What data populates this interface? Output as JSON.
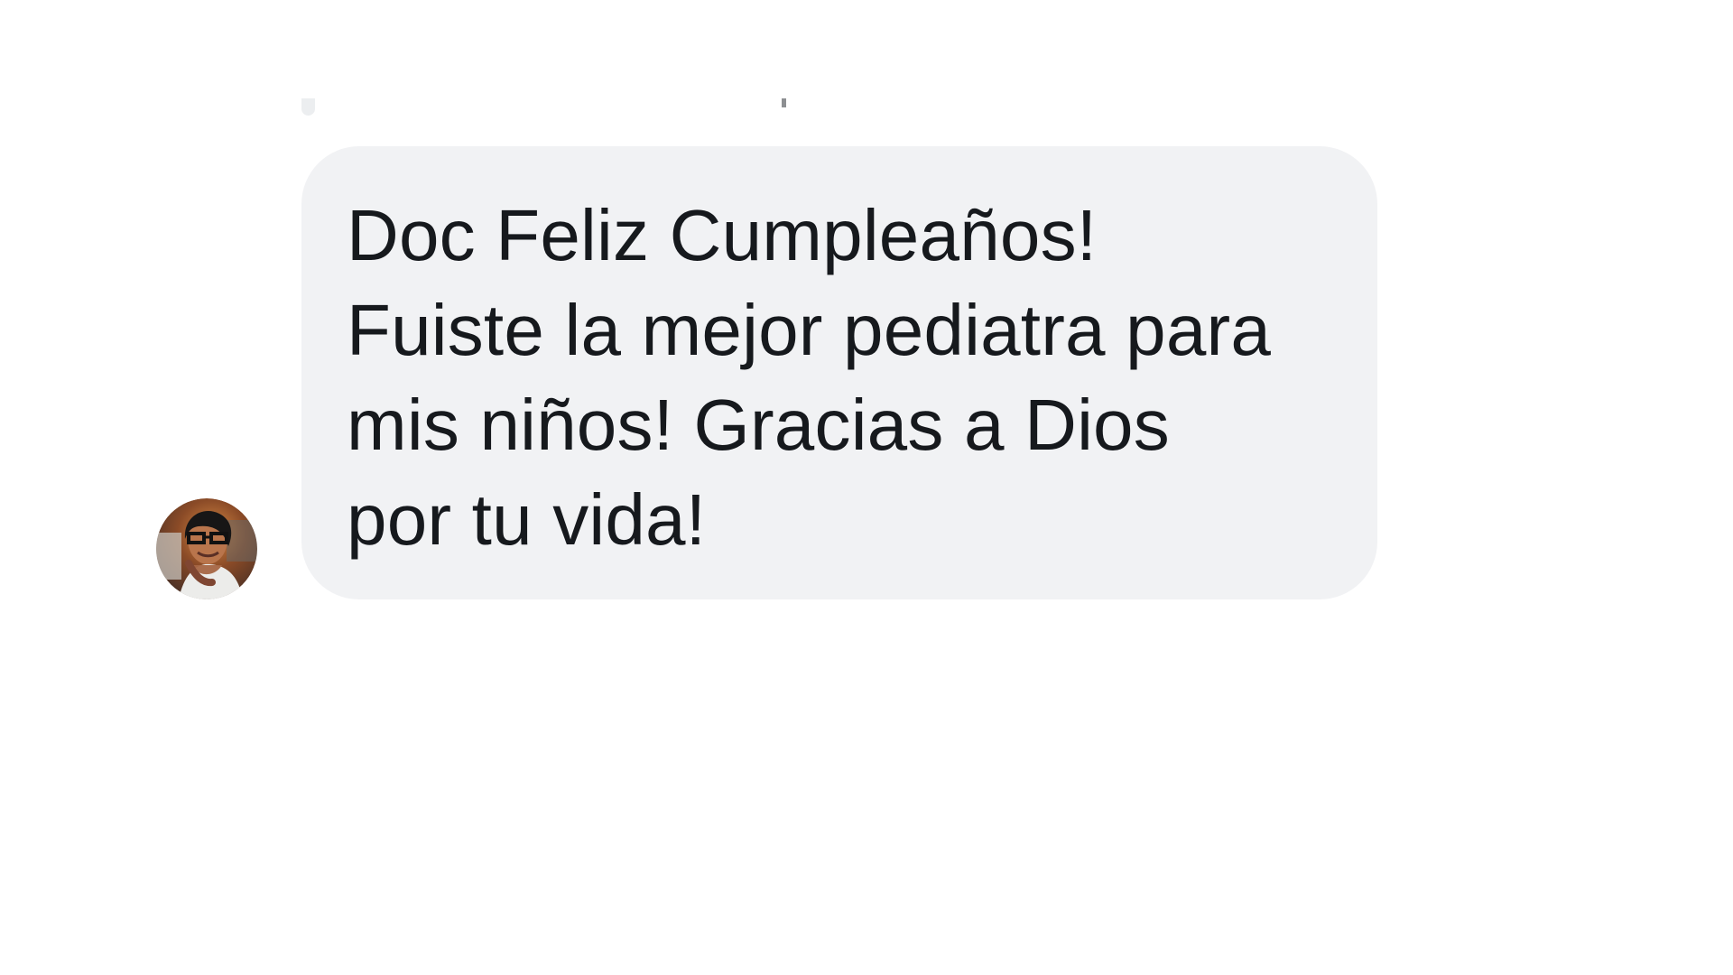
{
  "conversation": {
    "incoming_message": {
      "avatar_icon": "user-photo-avatar",
      "text": "Doc Feliz Cumpleaños!\nFuiste la mejor pediatra para\nmis niños! Gracias a Dios\npor tu vida!"
    }
  }
}
